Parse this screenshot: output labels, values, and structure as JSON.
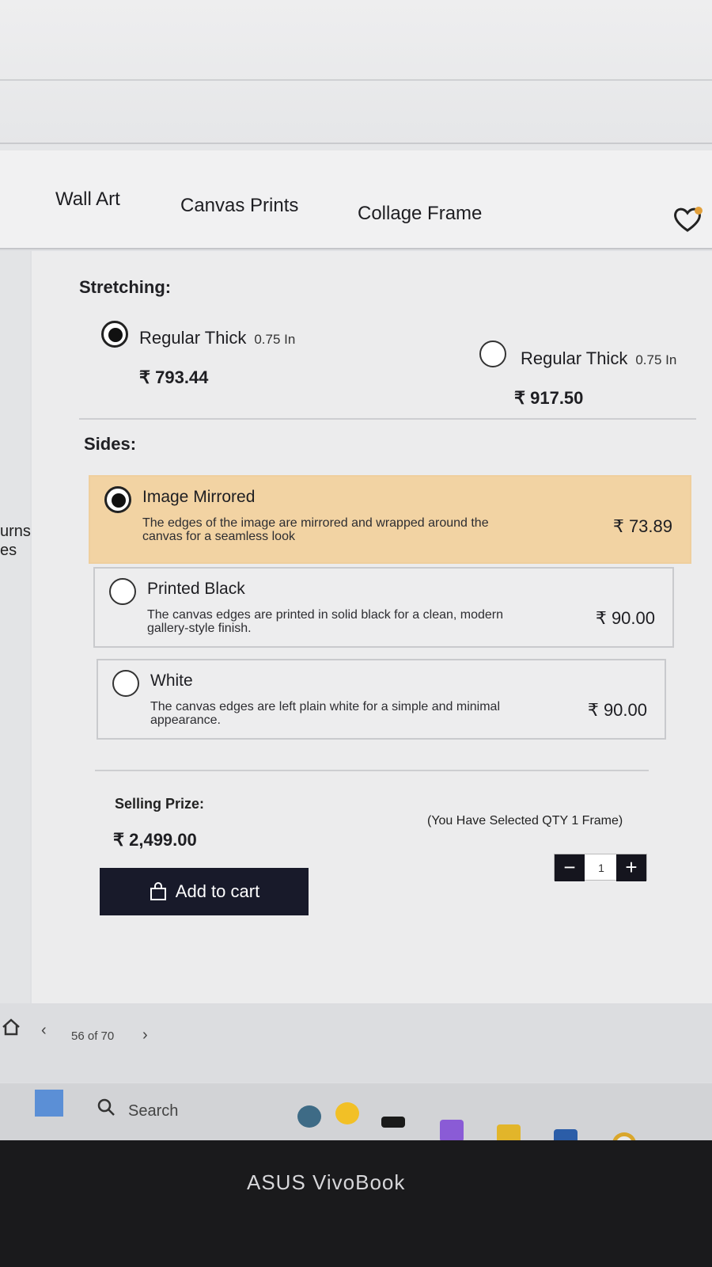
{
  "nav": {
    "items": [
      {
        "label": "Wall Art"
      },
      {
        "label": "Canvas Prints"
      },
      {
        "label": "Collage Frame"
      }
    ]
  },
  "left_edge": {
    "text1": "urns",
    "text2": "es"
  },
  "stretching": {
    "label": "Stretching:",
    "options": [
      {
        "title": "Regular Thick",
        "unit": "0.75 In",
        "price": "₹ 793.44",
        "selected": true
      },
      {
        "title": "Regular Thick",
        "unit": "0.75 In",
        "price": "₹ 917.50",
        "selected": false
      }
    ]
  },
  "sides": {
    "label": "Sides:",
    "options": [
      {
        "title": "Image Mirrored",
        "desc": "The edges of the image are mirrored and wrapped around the canvas for a seamless look",
        "price": "₹ 73.89",
        "selected": true
      },
      {
        "title": "Printed Black",
        "desc": "The canvas edges are printed in solid black for a clean, modern gallery-style finish.",
        "price": "₹ 90.00",
        "selected": false
      },
      {
        "title": "White",
        "desc": "The canvas edges are left plain white for a simple and minimal appearance.",
        "price": "₹ 90.00",
        "selected": false
      }
    ]
  },
  "purchase": {
    "selling_label": "Selling Prize:",
    "selling_price": "₹ 2,499.00",
    "qty_note": "(You Have Selected QTY 1 Frame)",
    "qty_value": "1",
    "qty_minus": "−",
    "qty_plus": "+",
    "add_to_cart": "Add to cart"
  },
  "pager": {
    "text": "56 of 70"
  },
  "taskbar": {
    "search_label": "Search"
  },
  "bezel": {
    "brand": "ASUS VivoBook"
  },
  "colors": {
    "selected_card": "#f2d3a3",
    "button_dark": "#181a2a"
  }
}
